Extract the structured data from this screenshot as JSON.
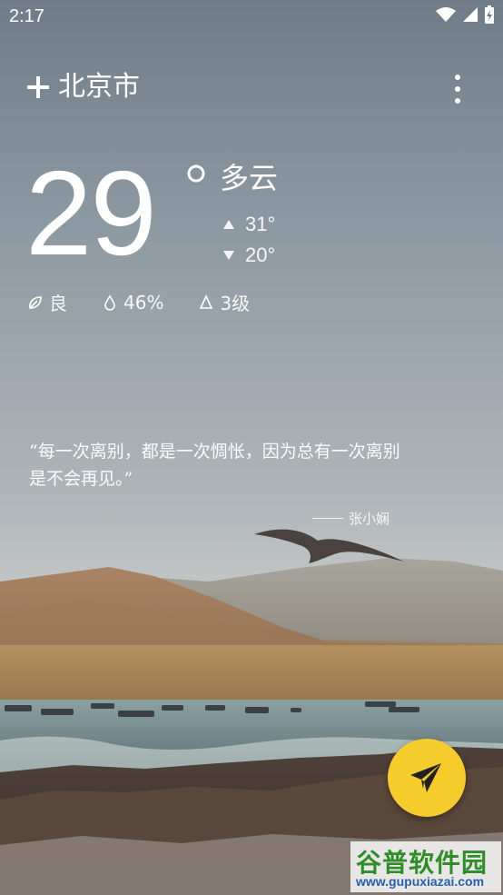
{
  "status_bar": {
    "time": "2:17",
    "icons": [
      "wifi-icon",
      "cellular-signal-icon",
      "battery-charging-icon"
    ]
  },
  "header": {
    "city": "北京市",
    "add_icon": "plus-icon",
    "menu_icon": "more-vertical-icon"
  },
  "weather": {
    "temperature": "29",
    "condition": "多云",
    "high": "31°",
    "low": "20°",
    "air_quality": "良",
    "humidity": "46%",
    "wind": "3级"
  },
  "quote": {
    "text": "“每一次离别，都是一次惆怅，因为总有一次离别是不会再见。”",
    "author": "张小娴"
  },
  "fab": {
    "icon": "send-paper-plane-icon"
  },
  "watermark": {
    "brand": "谷普软件园",
    "url": "www.gupuxiazai.com"
  },
  "colors": {
    "fab": "#f6cc2c",
    "text": "#ffffff",
    "sky_top": "#7f8b95",
    "sand": "#b88d60",
    "water": "#7f9a9e"
  }
}
